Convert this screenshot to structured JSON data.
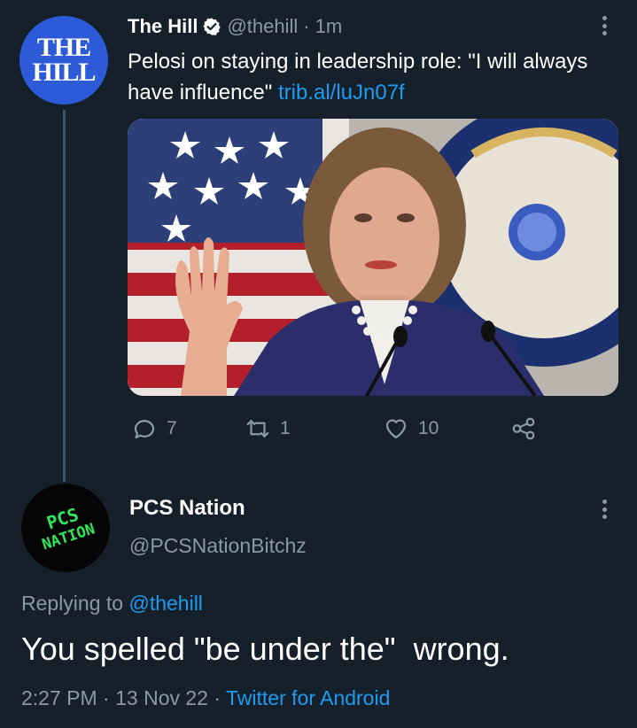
{
  "tweet": {
    "author_name": "The Hill",
    "handle": "@thehill",
    "separator": "·",
    "time": "1m",
    "avatar_text_line1": "THE",
    "avatar_text_line2": "HILL",
    "text": "Pelosi on staying in leadership role: \"I will always have influence\" ",
    "link": "trib.al/luJn07f",
    "image_icon": "press-conference-photo",
    "stats": {
      "replies": "7",
      "retweets": "1",
      "likes": "10"
    }
  },
  "reply": {
    "author_name": "PCS Nation",
    "handle": "@PCSNationBitchz",
    "avatar_text_line1": "PCS",
    "avatar_text_line2": "NATION",
    "replying_prefix": "Replying to ",
    "replying_to": "@thehill",
    "text": "You spelled \"be under the\"  wrong.",
    "time": "2:27 PM",
    "separator1": "·",
    "date": "13 Nov 22",
    "separator2": "·",
    "source": "Twitter for Android"
  },
  "colors": {
    "background": "#15202b",
    "accent": "#1d9bf0",
    "secondary_text": "#8b98a5",
    "hill_avatar": "#2d5bd8",
    "pcs_green": "#2ee85a"
  }
}
